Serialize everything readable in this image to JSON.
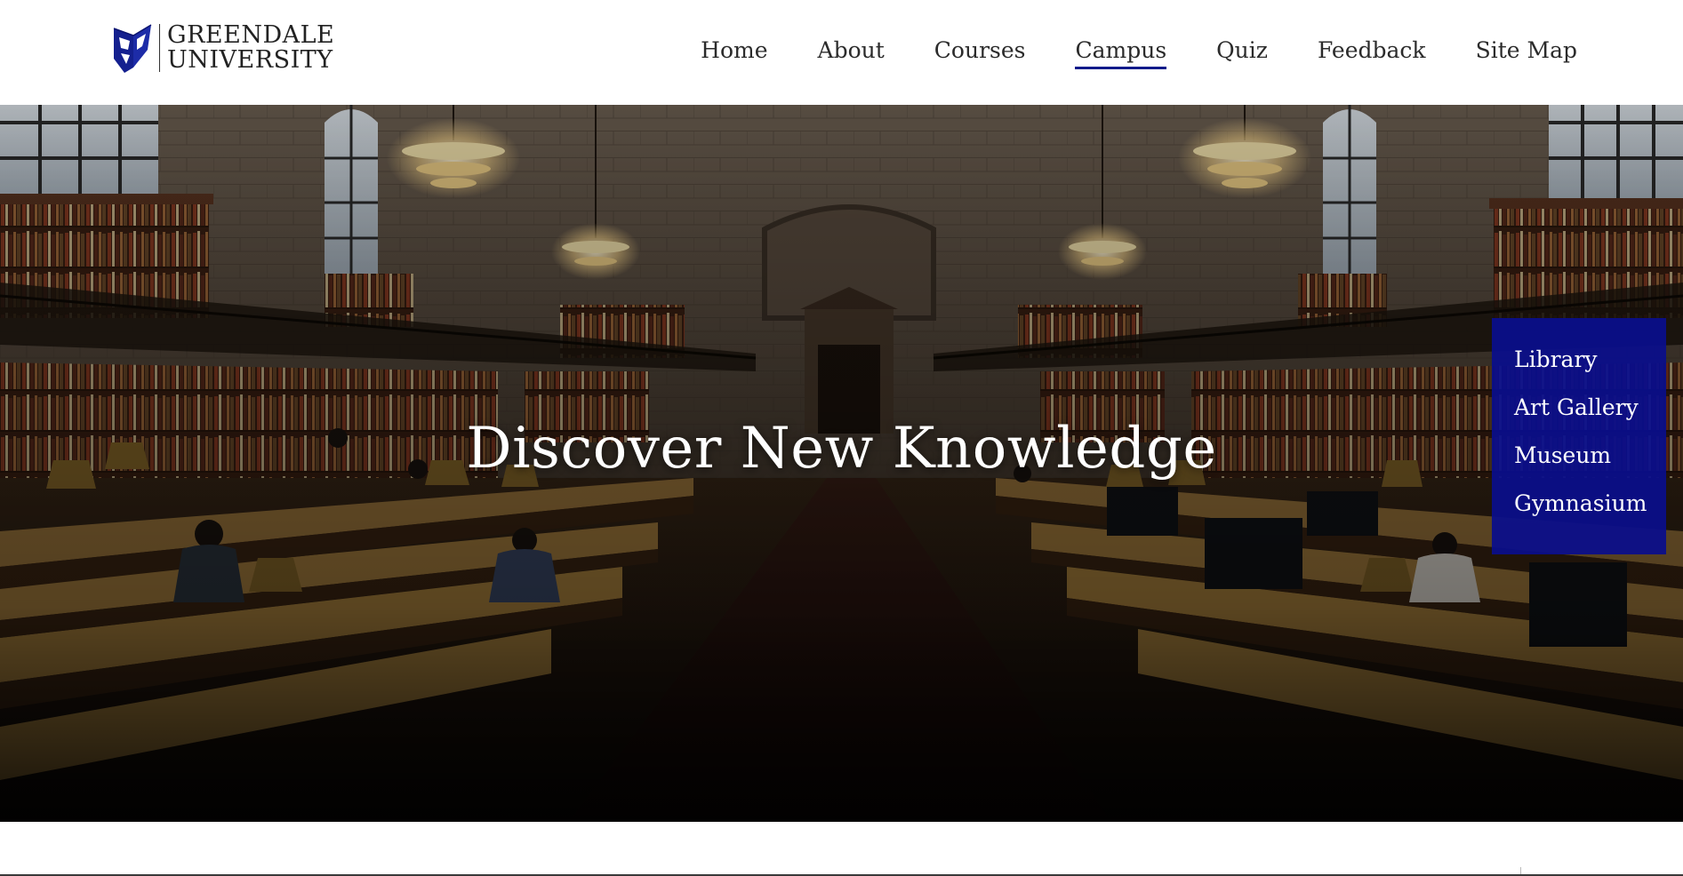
{
  "brand": {
    "line1": "GREENDALE",
    "line2": "UNIVERSITY",
    "logo_icon": "shield-flag-icon",
    "logo_color": "#14208f"
  },
  "nav": {
    "items": [
      {
        "label": "Home"
      },
      {
        "label": "About"
      },
      {
        "label": "Courses"
      },
      {
        "label": "Campus",
        "active": true
      },
      {
        "label": "Quiz"
      },
      {
        "label": "Feedback"
      },
      {
        "label": "Site Map"
      }
    ],
    "active_underline_color": "#0f1a8a"
  },
  "hero": {
    "title": "Discover New Knowledge"
  },
  "campus_menu": {
    "items": [
      {
        "label": "Library"
      },
      {
        "label": "Art Gallery"
      },
      {
        "label": "Museum"
      },
      {
        "label": "Gymnasium"
      }
    ],
    "background": "#0a0e8c"
  }
}
